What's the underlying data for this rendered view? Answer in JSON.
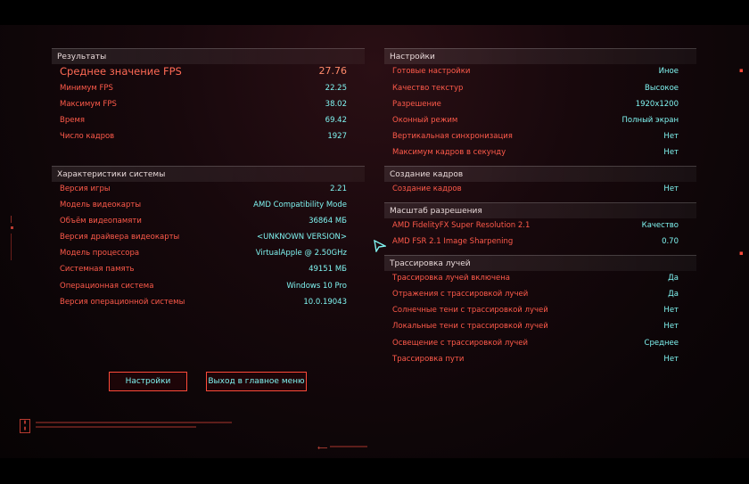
{
  "results": {
    "header": "Результаты",
    "rows": [
      {
        "label": "Среднее значение FPS",
        "value": "27.76"
      },
      {
        "label": "Минимум FPS",
        "value": "22.25"
      },
      {
        "label": "Максимум FPS",
        "value": "38.02"
      },
      {
        "label": "Время",
        "value": "69.42"
      },
      {
        "label": "Число кадров",
        "value": "1927"
      }
    ]
  },
  "system": {
    "header": "Характеристики системы",
    "rows": [
      {
        "label": "Версия игры",
        "value": "2.21"
      },
      {
        "label": "Модель видеокарты",
        "value": "AMD Compatibility Mode"
      },
      {
        "label": "Объём видеопамяти",
        "value": "36864 МБ"
      },
      {
        "label": "Версия драйвера видеокарты",
        "value": "<UNKNOWN VERSION>"
      },
      {
        "label": "Модель процессора",
        "value": "VirtualApple @ 2.50GHz"
      },
      {
        "label": "Системная память",
        "value": "49151 МБ"
      },
      {
        "label": "Операционная система",
        "value": "Windows 10 Pro"
      },
      {
        "label": "Версия операционной системы",
        "value": "10.0.19043"
      }
    ]
  },
  "settings": {
    "header": "Настройки",
    "rows": [
      {
        "label": "Готовые настройки",
        "value": "Иное"
      },
      {
        "label": "Качество текстур",
        "value": "Высокое"
      },
      {
        "label": "Разрешение",
        "value": "1920x1200"
      },
      {
        "label": "Оконный режим",
        "value": "Полный экран"
      },
      {
        "label": "Вертикальная синхронизация",
        "value": "Нет"
      },
      {
        "label": "Максимум кадров в секунду",
        "value": "Нет"
      }
    ]
  },
  "framegen": {
    "header": "Создание кадров",
    "rows": [
      {
        "label": "Создание кадров",
        "value": "Нет"
      }
    ]
  },
  "scaling": {
    "header": "Масштаб разрешения",
    "rows": [
      {
        "label": "AMD FidelityFX Super Resolution 2.1",
        "value": "Качество"
      },
      {
        "label": "AMD FSR 2.1 Image Sharpening",
        "value": "0.70"
      }
    ]
  },
  "raytracing": {
    "header": "Трассировка лучей",
    "rows": [
      {
        "label": "Трассировка лучей включена",
        "value": "Да"
      },
      {
        "label": "Отражения с трассировкой лучей",
        "value": "Да"
      },
      {
        "label": "Солнечные тени с трассировкой лучей",
        "value": "Нет"
      },
      {
        "label": "Локальные тени с трассировкой лучей",
        "value": "Нет"
      },
      {
        "label": "Освещение с трассировкой лучей",
        "value": "Среднее"
      },
      {
        "label": "Трассировка пути",
        "value": "Нет"
      }
    ]
  },
  "buttons": {
    "settings": "Настройки",
    "exit": "Выход в главное меню"
  },
  "colors": {
    "label": "#ff5a4a",
    "value": "#7ff3f0",
    "accent": "#ff4a3a"
  }
}
